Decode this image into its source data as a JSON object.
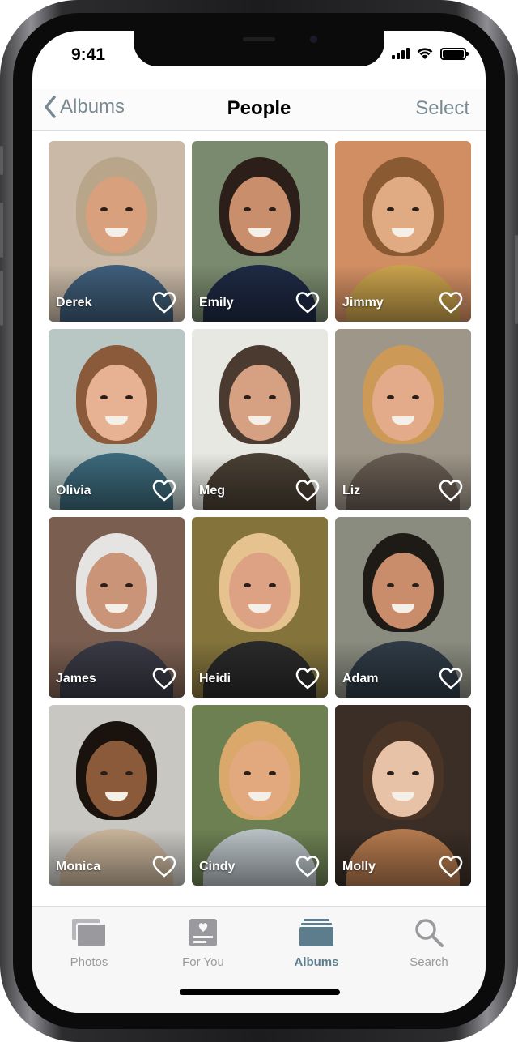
{
  "status_bar": {
    "time": "9:41",
    "icons": [
      "cellular-signal-icon",
      "wifi-icon",
      "battery-icon"
    ]
  },
  "nav": {
    "back_label": "Albums",
    "title": "People",
    "select_label": "Select"
  },
  "people": [
    {
      "name": "Derek",
      "skin": "#d9a07e",
      "hair": "#b9a58a",
      "bg": "#c9b9a6",
      "shirt": "#3f5e7a",
      "favorite": false
    },
    {
      "name": "Emily",
      "skin": "#c98f6c",
      "hair": "#2c1f1a",
      "bg": "#7a8a6e",
      "shirt": "#1e2a44",
      "favorite": false
    },
    {
      "name": "Jimmy",
      "skin": "#e0aa82",
      "hair": "#8a5a32",
      "bg": "#d28e63",
      "shirt": "#c9a24c",
      "favorite": false
    },
    {
      "name": "Olivia",
      "skin": "#e7b193",
      "hair": "#8b5a3a",
      "bg": "#b8c7c3",
      "shirt": "#3c6a7c",
      "favorite": false
    },
    {
      "name": "Meg",
      "skin": "#d6a183",
      "hair": "#4a3a30",
      "bg": "#e8e8e2",
      "shirt": "#4a4034",
      "favorite": false
    },
    {
      "name": "Liz",
      "skin": "#e3ab8a",
      "hair": "#cc9a56",
      "bg": "#9e9688",
      "shirt": "#6a5e54",
      "favorite": false
    },
    {
      "name": "James",
      "skin": "#c99478",
      "hair": "#e6e4e2",
      "bg": "#7a5e50",
      "shirt": "#3a3a46",
      "favorite": false
    },
    {
      "name": "Heidi",
      "skin": "#dda184",
      "hair": "#e6c28e",
      "bg": "#84743c",
      "shirt": "#2a2a2a",
      "favorite": false
    },
    {
      "name": "Adam",
      "skin": "#c98d6c",
      "hair": "#1e1a16",
      "bg": "#8a8c80",
      "shirt": "#2f3b46",
      "favorite": false
    },
    {
      "name": "Monica",
      "skin": "#8a5a3a",
      "hair": "#1a120c",
      "bg": "#c9c7c2",
      "shirt": "#c9b49a",
      "favorite": false
    },
    {
      "name": "Cindy",
      "skin": "#e2a97e",
      "hair": "#d9a86a",
      "bg": "#6c8052",
      "shirt": "#b9c2c6",
      "favorite": false
    },
    {
      "name": "Molly",
      "skin": "#e8c2a6",
      "hair": "#4a3426",
      "bg": "#3a2e26",
      "shirt": "#b57a4e",
      "favorite": false
    }
  ],
  "tabs": [
    {
      "label": "Photos",
      "icon": "photos-stack-icon",
      "active": false
    },
    {
      "label": "For You",
      "icon": "for-you-heart-icon",
      "active": false
    },
    {
      "label": "Albums",
      "icon": "albums-icon",
      "active": true
    },
    {
      "label": "Search",
      "icon": "search-icon",
      "active": false
    }
  ],
  "colors": {
    "accent": "#5e7d8c",
    "inactive": "#9a9a9e",
    "nav_link": "#7a8a92"
  }
}
